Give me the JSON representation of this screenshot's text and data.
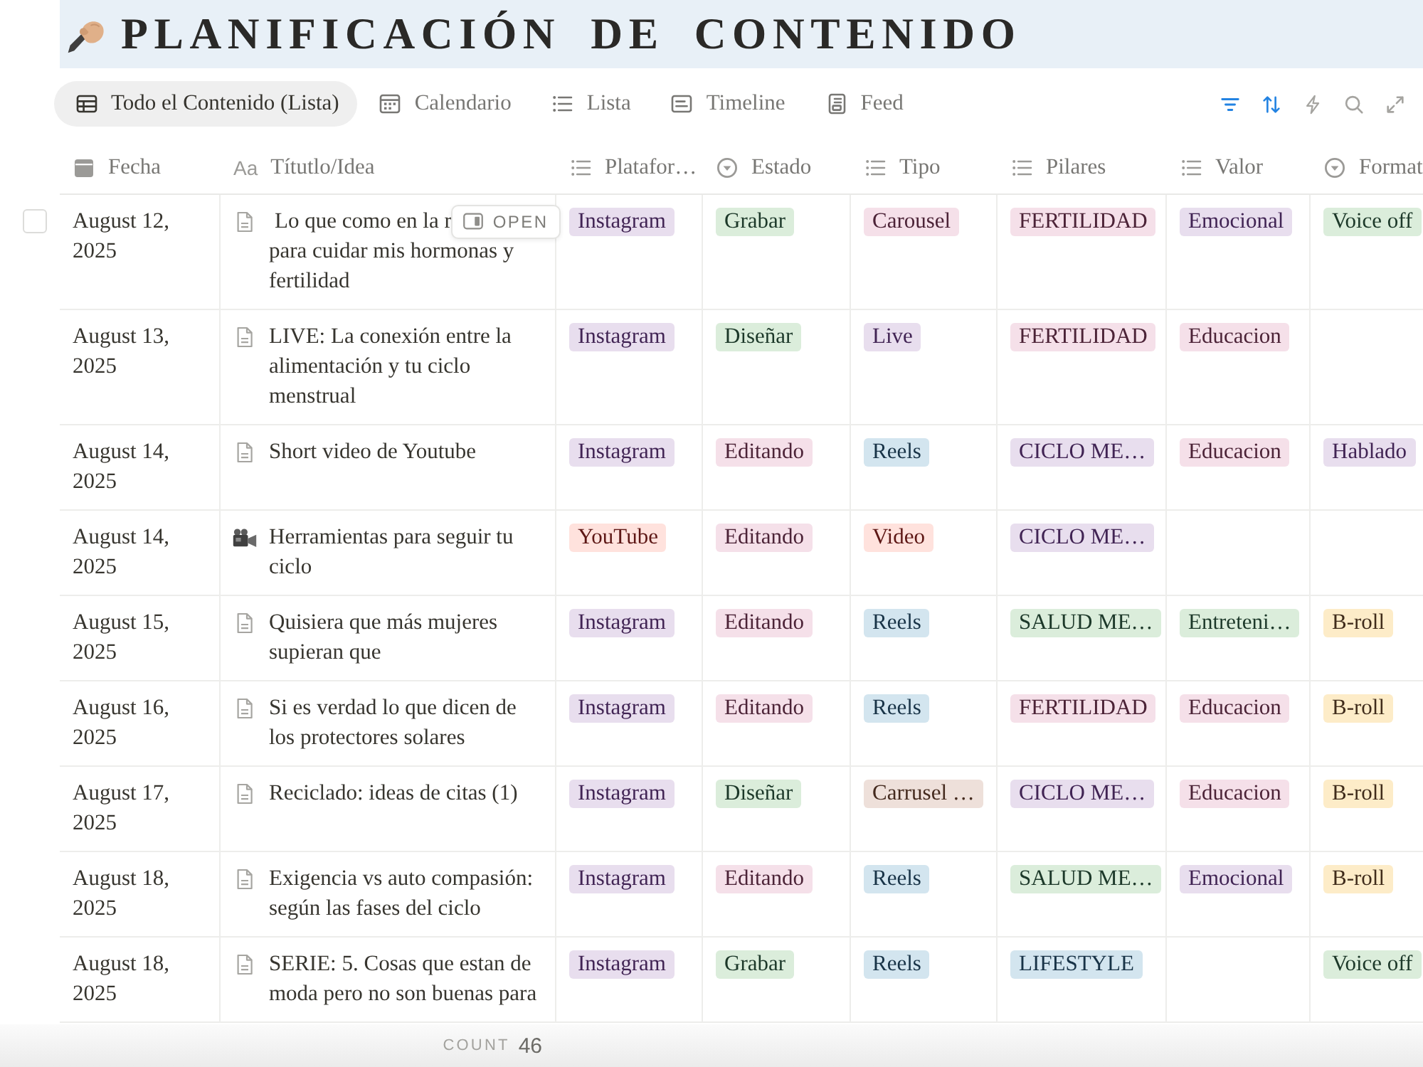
{
  "banner": {
    "title": "PLANIFICACIÓN DE CONTENIDO"
  },
  "tabs": [
    {
      "label": "Todo el Contenido (Lista)",
      "kind": "table",
      "selected": true
    },
    {
      "label": "Calendario",
      "kind": "calendar",
      "selected": false
    },
    {
      "label": "Lista",
      "kind": "list",
      "selected": false
    },
    {
      "label": "Timeline",
      "kind": "timeline",
      "selected": false
    },
    {
      "label": "Feed",
      "kind": "feed",
      "selected": false
    }
  ],
  "toolbar": [
    {
      "kind": "filter",
      "active": true
    },
    {
      "kind": "sort",
      "active": true
    },
    {
      "kind": "automation",
      "active": false
    },
    {
      "kind": "search",
      "active": false
    },
    {
      "kind": "expand",
      "active": false
    }
  ],
  "table": {
    "columns": [
      {
        "label": "Fecha",
        "kind": "date"
      },
      {
        "label": "Títutlo/Idea",
        "kind": "title",
        "glyph": "Aa"
      },
      {
        "label": "Platafor…",
        "kind": "multi"
      },
      {
        "label": "Estado",
        "kind": "status"
      },
      {
        "label": "Tipo",
        "kind": "multi"
      },
      {
        "label": "Pilares",
        "kind": "multi"
      },
      {
        "label": "Valor",
        "kind": "multi"
      },
      {
        "label": "Format",
        "kind": "status"
      }
    ],
    "rows": [
      {
        "kind": "page",
        "checked": false,
        "date": "August 12, 2025",
        "title": "Lo que como en la r",
        "open_button": "OPEN",
        "title_rest": "para cuidar mis hormonas y fertilidad",
        "plataforma": {
          "label": "Instagram",
          "color": "#e8deee"
        },
        "estado": {
          "label": "Grabar",
          "color": "#dbeddb"
        },
        "tipo": {
          "label": "Carousel",
          "color": "#f5e0e9"
        },
        "pilares": {
          "label": "FERTILIDAD",
          "color": "#f5e0e9"
        },
        "valor": {
          "label": "Emocional",
          "color": "#e8deee"
        },
        "format": {
          "label": "Voice off",
          "color": "#dbeddb"
        }
      },
      {
        "kind": "page",
        "date": "August 13, 2025",
        "title": "LIVE: La conexión entre la alimentación y tu ciclo menstrual",
        "plataforma": {
          "label": "Instagram",
          "color": "#e8deee"
        },
        "estado": {
          "label": "Diseñar",
          "color": "#dbeddb"
        },
        "tipo": {
          "label": "Live",
          "color": "#e8deee"
        },
        "pilares": {
          "label": "FERTILIDAD",
          "color": "#f5e0e9"
        },
        "valor": {
          "label": "Educacion",
          "color": "#f5e0e9"
        }
      },
      {
        "kind": "page",
        "date": "August 14, 2025",
        "title": "Short video de Youtube",
        "plataforma": {
          "label": "Instagram",
          "color": "#e8deee"
        },
        "estado": {
          "label": "Editando",
          "color": "#f5e0e9"
        },
        "tipo": {
          "label": "Reels",
          "color": "#d3e5ef"
        },
        "pilares": {
          "label": "CICLO ME…",
          "color": "#e8deee"
        },
        "valor": {
          "label": "Educacion",
          "color": "#f5e0e9"
        },
        "format": {
          "label": "Hablado",
          "color": "#e8deee"
        }
      },
      {
        "kind": "video",
        "date": "August 14, 2025",
        "title": "Herramientas para seguir tu ciclo",
        "plataforma": {
          "label": "YouTube",
          "color": "#ffe2dd"
        },
        "estado": {
          "label": "Editando",
          "color": "#f5e0e9"
        },
        "tipo": {
          "label": "Video",
          "color": "#ffe2dd"
        },
        "pilares": {
          "label": "CICLO ME…",
          "color": "#e8deee"
        }
      },
      {
        "kind": "page",
        "date": "August 15, 2025",
        "title": "Quisiera que más mujeres supieran que",
        "plataforma": {
          "label": "Instagram",
          "color": "#e8deee"
        },
        "estado": {
          "label": "Editando",
          "color": "#f5e0e9"
        },
        "tipo": {
          "label": "Reels",
          "color": "#d3e5ef"
        },
        "pilares": {
          "label": "SALUD ME…",
          "color": "#dbeddb"
        },
        "valor": {
          "label": "Entreteni…",
          "color": "#dbeddb"
        },
        "format": {
          "label": "B-roll",
          "color": "#fdecc8"
        }
      },
      {
        "kind": "page",
        "date": "August 16, 2025",
        "title": "Si es verdad lo que dicen de los protectores solares",
        "plataforma": {
          "label": "Instagram",
          "color": "#e8deee"
        },
        "estado": {
          "label": "Editando",
          "color": "#f5e0e9"
        },
        "tipo": {
          "label": "Reels",
          "color": "#d3e5ef"
        },
        "pilares": {
          "label": "FERTILIDAD",
          "color": "#f5e0e9"
        },
        "valor": {
          "label": "Educacion",
          "color": "#f5e0e9"
        },
        "format": {
          "label": "B-roll",
          "color": "#fdecc8"
        }
      },
      {
        "kind": "page",
        "date": "August 17, 2025",
        "title": "Reciclado: ideas de citas (1)",
        "plataforma": {
          "label": "Instagram",
          "color": "#e8deee"
        },
        "estado": {
          "label": "Diseñar",
          "color": "#dbeddb"
        },
        "tipo": {
          "label": "Carrusel …",
          "color": "#eee0da"
        },
        "pilares": {
          "label": "CICLO ME…",
          "color": "#e8deee"
        },
        "valor": {
          "label": "Educacion",
          "color": "#f5e0e9"
        },
        "format": {
          "label": "B-roll",
          "color": "#fdecc8"
        }
      },
      {
        "kind": "page",
        "date": "August 18, 2025",
        "title": "Exigencia vs auto compasión: según las fases del ciclo",
        "plataforma": {
          "label": "Instagram",
          "color": "#e8deee"
        },
        "estado": {
          "label": "Editando",
          "color": "#f5e0e9"
        },
        "tipo": {
          "label": "Reels",
          "color": "#d3e5ef"
        },
        "pilares": {
          "label": "SALUD ME…",
          "color": "#dbeddb"
        },
        "valor": {
          "label": "Emocional",
          "color": "#e8deee"
        },
        "format": {
          "label": "B-roll",
          "color": "#fdecc8"
        }
      },
      {
        "kind": "page",
        "date": "August 18, 2025",
        "title": "SERIE: 5. Cosas que estan de moda pero no son buenas para",
        "plataforma": {
          "label": "Instagram",
          "color": "#e8deee"
        },
        "estado": {
          "label": "Grabar",
          "color": "#dbeddb"
        },
        "tipo": {
          "label": "Reels",
          "color": "#d3e5ef"
        },
        "pilares": {
          "label": "LIFESTYLE",
          "color": "#d3e5ef"
        },
        "format": {
          "label": "Voice off",
          "color": "#dbeddb"
        }
      }
    ]
  },
  "footer": {
    "label": "COUNT",
    "value": "46"
  }
}
